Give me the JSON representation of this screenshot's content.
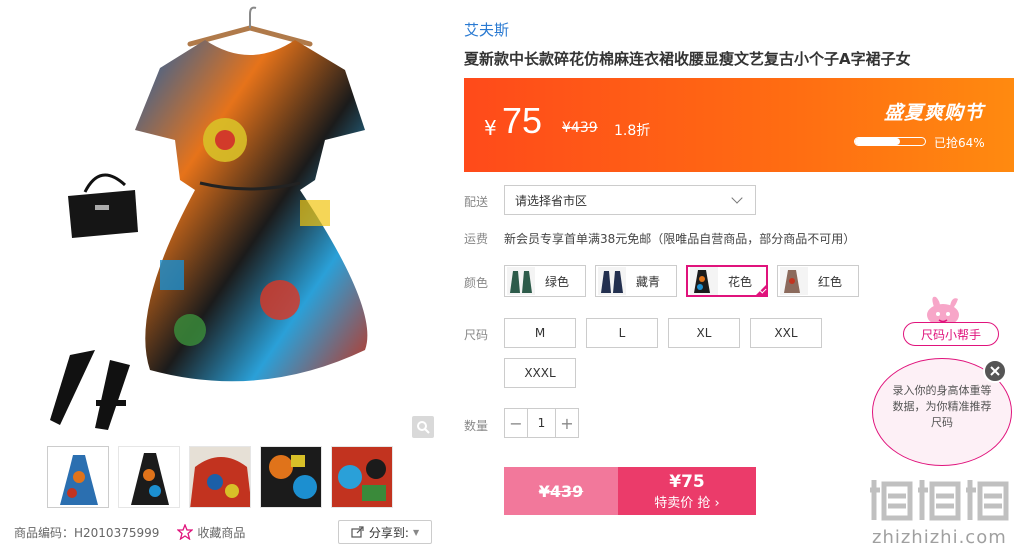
{
  "gallery": {
    "product_code_label": "商品编码：H2010375999",
    "favorite_label": "收藏商品",
    "share_label": "分享到:"
  },
  "product": {
    "brand": "艾夫斯",
    "title": "夏新款中长款碎花仿棉麻连衣裙收腰显瘦文艺复古小个子A字裙子女"
  },
  "price": {
    "currency": "¥",
    "now": "75",
    "original": "¥439",
    "discount": "1.8折",
    "promo_title": "盛夏爽购节",
    "sold_pct": 0.64,
    "sold_label": "已抢64%"
  },
  "shipping": {
    "label": "配送",
    "select_value": "请选择省市区",
    "fee_label": "运费",
    "fee_text": "新会员专享首单满38元免邮（限唯品自营商品，部分商品不可用）"
  },
  "colors": {
    "label": "颜色",
    "options": [
      "绿色",
      "藏青",
      "花色",
      "红色"
    ],
    "selected": "花色"
  },
  "sizes": {
    "label": "尺码",
    "options": [
      "M",
      "L",
      "XL",
      "XXL",
      "XXXL"
    ]
  },
  "quantity": {
    "label": "数量",
    "minus": "−",
    "value": "1",
    "plus": "+"
  },
  "buy": {
    "old_price": "¥439",
    "price": "¥75",
    "cta": "特卖价 抢 ›"
  },
  "size_helper": {
    "title": "尺码小帮手",
    "message": "录入你的身高体重等数据，为你精准推荐尺码"
  },
  "watermark": {
    "text": "zhizhizhi.com"
  },
  "colors_theme": {
    "accent_orange": "#ff5a16",
    "accent_pink": "#e0137c",
    "brand_blue": "#2a7ad2",
    "buy_pink": "#eb3b6a"
  }
}
